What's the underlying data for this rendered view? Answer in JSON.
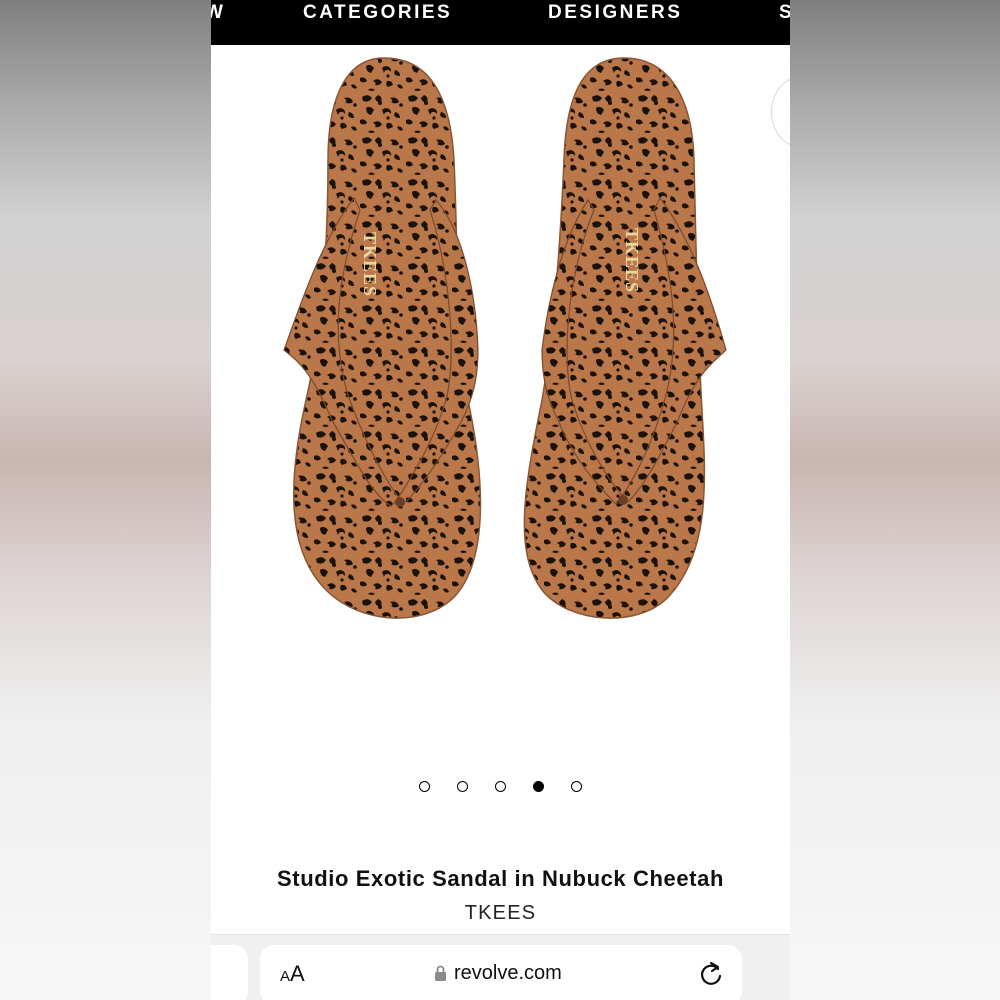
{
  "nav": {
    "cut_left": "W",
    "categories": "CATEGORIES",
    "designers": "DESIGNERS",
    "cut_right": "S"
  },
  "product": {
    "title": "Studio Exotic Sandal in Nubuck Cheetah",
    "brand": "TKEES",
    "sandal_logo_text": "TKEES",
    "image_icon": "cheetah-flip-flop-pair"
  },
  "carousel": {
    "total_slides": 5,
    "active_slide": 4
  },
  "browser": {
    "text_size_button": "AA",
    "url": "revolve.com",
    "lock_icon": "lock-icon",
    "reload_icon": "reload-icon"
  },
  "colors": {
    "nav_bg": "#000000",
    "nav_text": "#ffffff",
    "sandal_base": "#b9774a",
    "sandal_spots": "#1b120c",
    "logo_gold": "#e8d6a0"
  }
}
